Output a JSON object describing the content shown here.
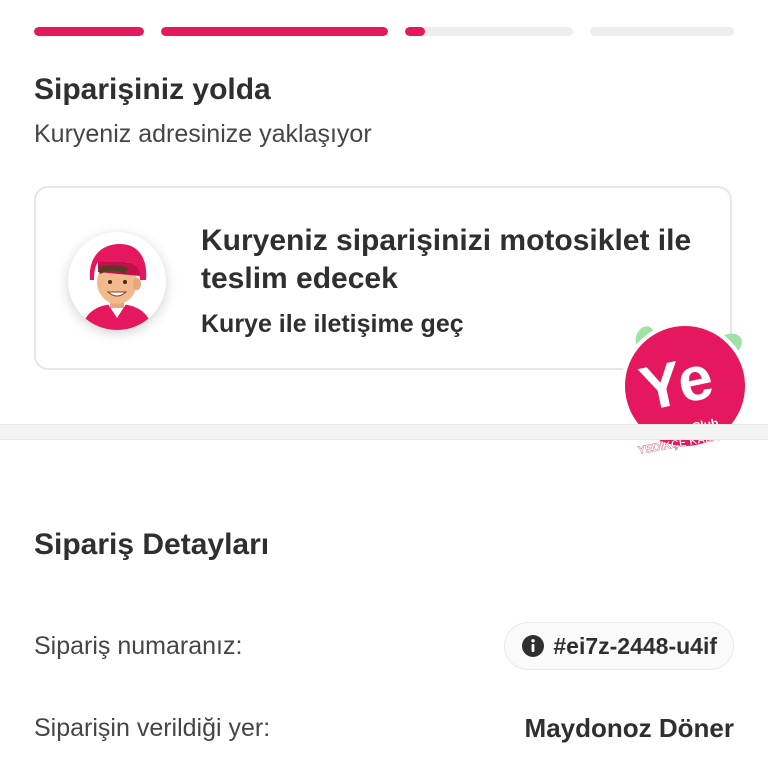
{
  "colors": {
    "accent": "#e5175f",
    "track": "#eeeeee",
    "text_dark": "#2f2f2f",
    "badge_green": "#9ee2a8"
  },
  "progress": {
    "steps": [
      {
        "fill_fraction": 1.0
      },
      {
        "fill_fraction": 1.0
      },
      {
        "fill_fraction": 0.12
      },
      {
        "fill_fraction": 0.0
      }
    ]
  },
  "status": {
    "title": "Siparişiniz yolda",
    "subtitle": "Kuryeniz adresinize yaklaşıyor"
  },
  "courier_card": {
    "title": "Kuryeniz siparişinizi motosiklet ile teslim edecek",
    "contact_link": "Kurye ile iletişime geç",
    "avatar_icon": "courier-avatar-icon"
  },
  "yeclub_badge": {
    "logo_text": "Ye",
    "brand": "YeClub",
    "slogan": "YEDİKÇE KAZAN!"
  },
  "order_details": {
    "title": "Sipariş Detayları",
    "order_number_label": "Sipariş numaranız:",
    "order_number": "#ei7z-2448-u4if",
    "info_icon": "info-icon",
    "place_label": "Siparişin verildiği yer:",
    "place_value": "Maydonoz Döner"
  }
}
